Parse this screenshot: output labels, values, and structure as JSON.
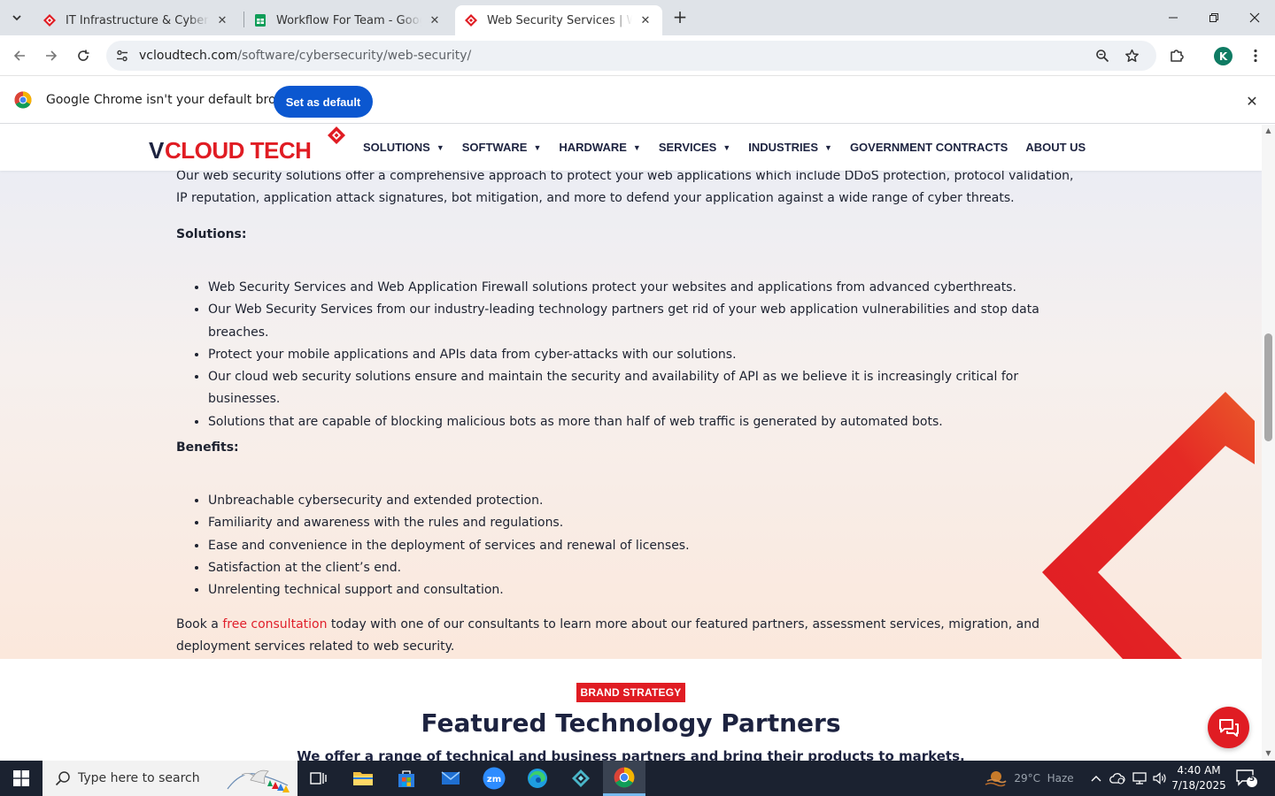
{
  "browser": {
    "tabs": [
      {
        "title": "IT Infrastructure & Cybersecurity",
        "favicon": "vcloud-diamond-icon"
      },
      {
        "title": "Workflow For Team - Google Sheets",
        "favicon": "google-sheets-icon"
      },
      {
        "title": "Web Security Services | Website",
        "favicon": "vcloud-diamond-icon",
        "active": true
      }
    ],
    "url_host": "vcloudtech.com",
    "url_path": "/software/cybersecurity/web-security/",
    "profile_initial": "K"
  },
  "infobar": {
    "message": "Google Chrome isn't your default browser",
    "button_label": "Set as default"
  },
  "site": {
    "logo_text": "VCLOUD TECH",
    "nav": [
      {
        "label": "SOLUTIONS",
        "has_dropdown": true
      },
      {
        "label": "SOFTWARE",
        "has_dropdown": true
      },
      {
        "label": "HARDWARE",
        "has_dropdown": true
      },
      {
        "label": "SERVICES",
        "has_dropdown": true
      },
      {
        "label": "INDUSTRIES",
        "has_dropdown": true
      },
      {
        "label": "GOVERNMENT CONTRACTS",
        "has_dropdown": false
      },
      {
        "label": "ABOUT US",
        "has_dropdown": false
      }
    ]
  },
  "content": {
    "intro": "Our web security solutions offer a comprehensive approach to protect your web applications which include DDoS protection, protocol validation, IP reputation, application attack signatures, bot mitigation, and more to defend your application against a wide range of cyber threats.",
    "solutions_heading": "Solutions:",
    "solutions": [
      "Web Security Services and Web Application Firewall solutions protect your websites and applications from advanced cyberthreats.",
      "Our Web Security Services from our industry-leading technology partners get rid of your web application vulnerabilities and stop data breaches.",
      "Protect your mobile applications and APIs data from cyber-attacks with our solutions.",
      "Our cloud web security solutions ensure and maintain the security and availability of API as we believe it is increasingly critical for businesses.",
      "Solutions that are capable of blocking malicious bots as more than half of web traffic is generated by automated bots."
    ],
    "benefits_heading": "Benefits:",
    "benefits": [
      "Unbreachable cybersecurity and extended protection.",
      "Familiarity and awareness with the rules and regulations.",
      "Ease and convenience in the deployment of services and renewal of licenses.",
      "Satisfaction at the client’s end.",
      "Unrelenting technical support and consultation."
    ],
    "cta_before": "Book a ",
    "cta_link": "free consultation",
    "cta_after": " today with one of our consultants to learn more about our featured partners, assessment services, migration, and deployment services related to web security."
  },
  "featured": {
    "badge": "BRAND STRATEGY",
    "title": "Featured Technology Partners",
    "subtitle": "We offer a range of technical and business partners and bring their products to markets."
  },
  "taskbar": {
    "search_placeholder": "Type here to search",
    "weather": "29°C  Haze",
    "time": "4:40 AM",
    "date": "7/18/2025",
    "notification_count": "5"
  },
  "colors": {
    "brand_red": "#e01c23",
    "brand_navy": "#1d2340",
    "chrome_blue": "#0b57d0"
  }
}
